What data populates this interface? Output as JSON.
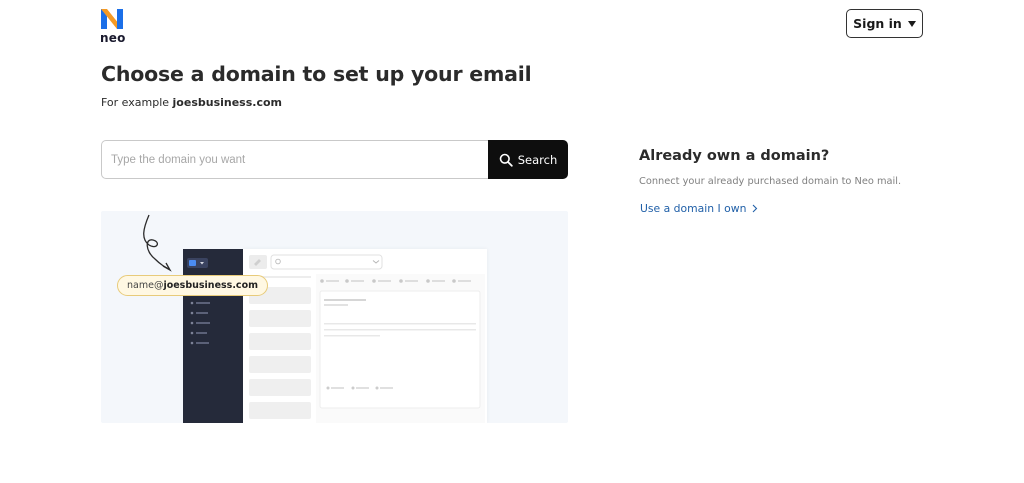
{
  "brand": {
    "name": "neo"
  },
  "header": {
    "signin_label": "Sign in"
  },
  "main": {
    "title": "Choose a domain to set up your email",
    "example_prefix": "For example ",
    "example_domain": "joesbusiness.com",
    "search": {
      "placeholder": "Type the domain you want",
      "value": "",
      "button_label": "Search"
    },
    "illustration": {
      "email_user": "name@",
      "email_domain": "joesbusiness.com"
    }
  },
  "side": {
    "title": "Already own a domain?",
    "description": "Connect your already purchased domain to Neo mail.",
    "link_label": "Use a domain I own"
  },
  "colors": {
    "accent_link": "#2160a8",
    "button_dark": "#0e0e0e",
    "sidebar_dark": "#252a3a",
    "chip_bg": "#fff8e3",
    "logo_blue": "#1b6fe8",
    "logo_orange": "#f59a23"
  },
  "icons": {
    "logo": "neo-logo-icon",
    "signin_caret": "caret-down-icon",
    "search": "search-icon",
    "link_arrow": "chevron-right-icon"
  }
}
